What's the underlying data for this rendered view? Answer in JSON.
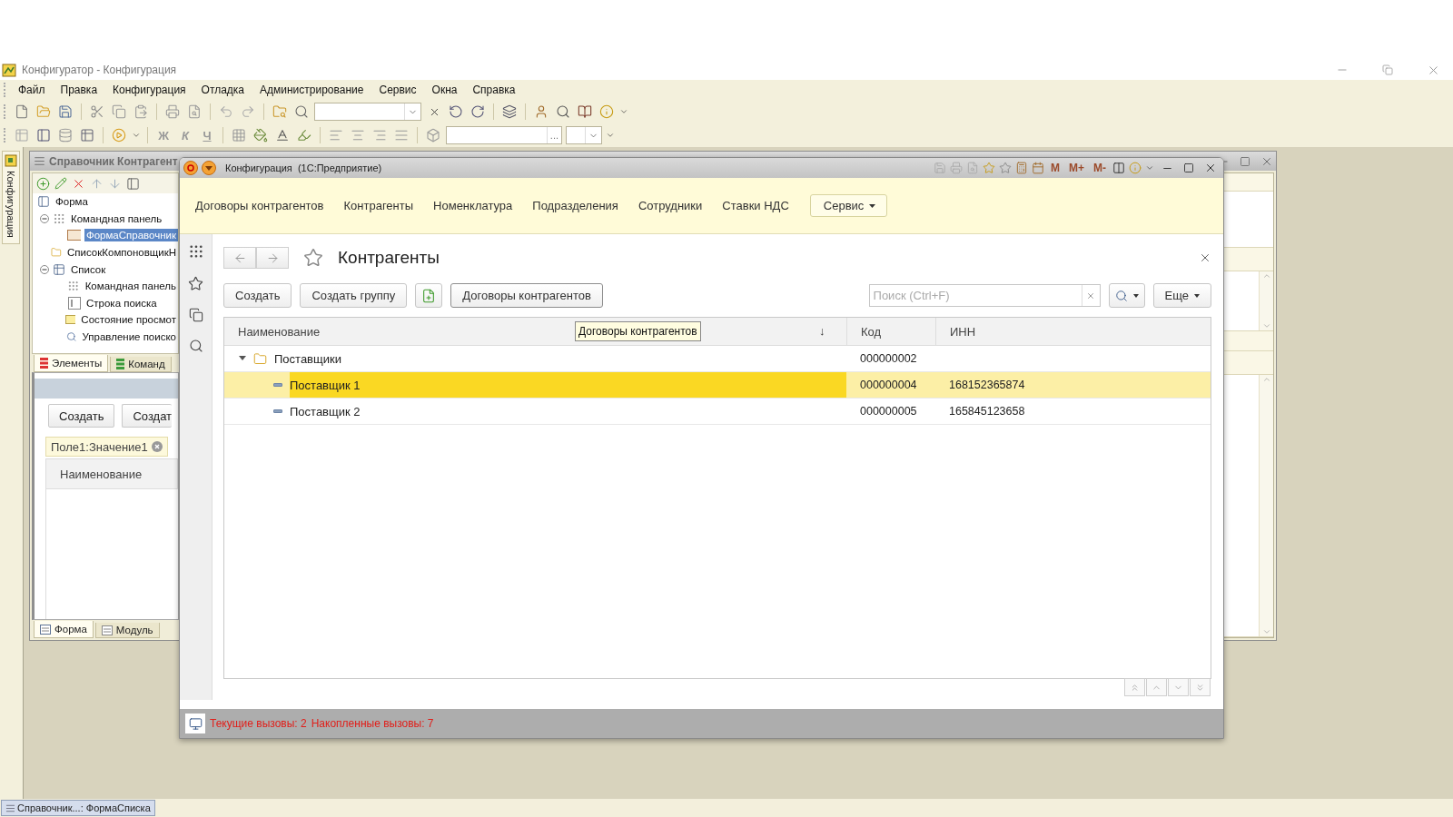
{
  "app_window": {
    "title": "Конфигуратор - Конфигурация"
  },
  "menu": [
    {
      "label": "Файл"
    },
    {
      "label": "Правка"
    },
    {
      "label": "Конфигурация"
    },
    {
      "label": "Отладка"
    },
    {
      "label": "Администрирование"
    },
    {
      "label": "Сервис"
    },
    {
      "label": "Окна"
    },
    {
      "label": "Справка"
    }
  ],
  "toolbar": {
    "format_buttons": [
      "Ж",
      "К",
      "Ч"
    ],
    "field_button": "..."
  },
  "side_panel": {
    "tab": "Конфигурация"
  },
  "form_editor": {
    "title": "Справочник Контрагент",
    "tree": {
      "label": "Форма",
      "children": [
        {
          "label": "Командная панель",
          "kind": "panel",
          "expanded": true,
          "selected": false,
          "children": [
            {
              "label": "ФормаСправочник",
              "kind": "button",
              "selected": true
            }
          ]
        },
        {
          "label": "СписокКомпоновщикН",
          "kind": "folder",
          "selected": false
        },
        {
          "label": "Список",
          "kind": "table",
          "expanded": true,
          "selected": false,
          "children": [
            {
              "label": "Командная панель",
              "kind": "panel",
              "selected": false
            },
            {
              "label": "Строка поиска",
              "kind": "field",
              "selected": false
            },
            {
              "label": "Состояние просмот",
              "kind": "status",
              "selected": false
            },
            {
              "label": "Управление поиско",
              "kind": "search",
              "selected": false
            }
          ]
        }
      ]
    },
    "tabs": [
      {
        "label": "Элементы",
        "selected": true
      },
      {
        "label": "Команд",
        "selected": false
      }
    ],
    "preview": {
      "buttons": [
        "Создать",
        "Создат"
      ],
      "filter": "Поле1:Значение1",
      "column": "Наименование"
    },
    "bottom_tabs": [
      {
        "label": "Форма",
        "selected": true
      },
      {
        "label": "Модуль",
        "selected": false
      }
    ]
  },
  "client_window": {
    "title": "Конфигурация  (1С:Предприятие)",
    "memory_buttons": [
      "M",
      "M+",
      "M-"
    ],
    "sections": [
      {
        "label": "Договоры контрагентов"
      },
      {
        "label": "Контрагенты"
      },
      {
        "label": "Номенклатура"
      },
      {
        "label": "Подразделения"
      },
      {
        "label": "Сотрудники"
      },
      {
        "label": "Ставки НДС"
      }
    ],
    "service_menu": "Сервис",
    "page_title": "Контрагенты",
    "commands": [
      "Создать",
      "Создать группу"
    ],
    "linked_command": "Договоры контрагентов",
    "search": {
      "placeholder": "Поиск (Ctrl+F)"
    },
    "more": "Еще",
    "table": {
      "columns": [
        "Наименование",
        "Код",
        "ИНН"
      ],
      "sort_arrow": "↓",
      "tooltip": "Договоры контрагентов",
      "rows": [
        {
          "kind": "group",
          "name": "Поставщики",
          "code": "000000002",
          "expanded": true,
          "selected": false,
          "children": [
            {
              "kind": "item",
              "name": "Поставщик 1",
              "code": "000000004",
              "inn": "168152365874",
              "selected": true
            },
            {
              "kind": "item",
              "name": "Поставщик 2",
              "code": "000000005",
              "inn": "165845123658",
              "selected": false
            }
          ]
        }
      ]
    },
    "status": [
      "Текущие вызовы: 2",
      "Накопленные вызовы: 7"
    ]
  },
  "taskbar": [
    {
      "label": "Справочник...: ФормаСписка",
      "selected": true
    }
  ]
}
